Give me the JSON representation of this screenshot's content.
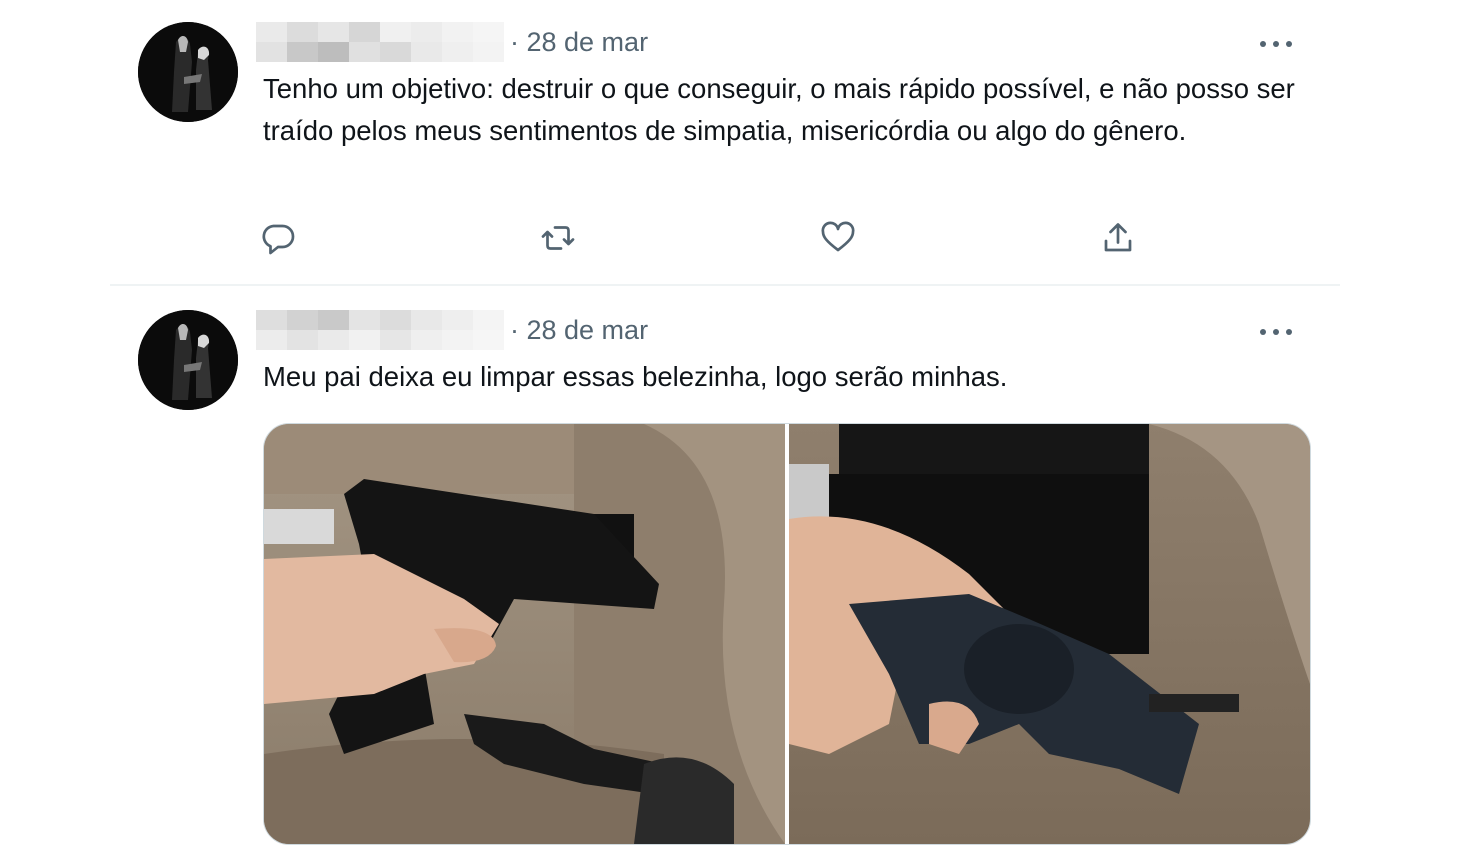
{
  "tweets": [
    {
      "date": "· 28 de mar",
      "text": "Tenho um objetivo: destruir o que conseguir, o mais rápido possível, e não posso ser traído pelos meus sentimentos de simpatia, misericórdia ou algo do gênero.",
      "actions": [
        "reply-icon",
        "retweet-icon",
        "like-icon",
        "share-icon"
      ]
    },
    {
      "date": "· 28 de mar",
      "text": "Meu pai deixa eu limpar essas belezinha, logo serão minhas.",
      "media": [
        "photo-pistol",
        "photo-revolver"
      ]
    }
  ],
  "colors": {
    "text": "#0f1419",
    "secondary": "#536471",
    "divider": "#eff3f4"
  }
}
